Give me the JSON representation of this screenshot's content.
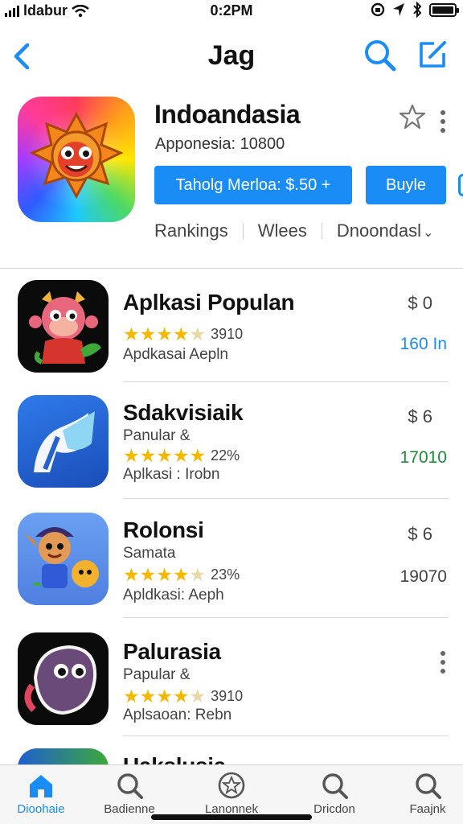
{
  "status_bar": {
    "carrier": "ldabur",
    "time": "0:2PM"
  },
  "nav": {
    "title": "Jag"
  },
  "featured": {
    "name": "Indoandasia",
    "subtitle": "Apponesia: 10800",
    "primary_button": "Taholg Merloa: $.50 +",
    "buy_button": "Buyle",
    "tabs": [
      "Rankings",
      "Wlees",
      "Dnoondasl"
    ]
  },
  "apps": [
    {
      "title": "Aplkasi Populan",
      "subtitle": "",
      "rating": 4.5,
      "rating_count": "3910",
      "category": "Apdkasai Aepln",
      "price": "$ 0",
      "value": "160 In",
      "value_color": "#1a8cf5",
      "icon": "monkey-app-icon"
    },
    {
      "title": "Sdakvisiaik",
      "subtitle": "Panular &",
      "rating": 5,
      "rating_count": "22%",
      "category": "Aplkasi : Irobn",
      "price": "$ 6",
      "value": "17010",
      "value_color": "#1f8a3a",
      "icon": "stylized-p-app-icon"
    },
    {
      "title": "Rolonsi",
      "subtitle": "Samata",
      "rating": 4.5,
      "rating_count": "23%",
      "category": "Apldkasi: Aeph",
      "price": "$ 6",
      "value": "19070",
      "value_color": "#444444",
      "icon": "cartoon-characters-app-icon"
    },
    {
      "title": "Palurasia",
      "subtitle": "Papular &",
      "rating": 4.5,
      "rating_count": "3910",
      "category": "Aplsaoan: Rebn",
      "price": "",
      "value": "",
      "value_color": "#444444",
      "icon": "creature-app-icon"
    }
  ],
  "partial_row": {
    "title": "Uakslusia"
  },
  "tab_bar": [
    {
      "label": "Dioohaie",
      "icon": "home-icon"
    },
    {
      "label": "Badienne",
      "icon": "search-icon"
    },
    {
      "label": "Lanonnek",
      "icon": "star-icon"
    },
    {
      "label": "Dricdon",
      "icon": "search-icon"
    },
    {
      "label": "Faajnk",
      "icon": "search-icon"
    }
  ],
  "colors": {
    "accent": "#1a8cf5",
    "star": "#f5b800"
  }
}
